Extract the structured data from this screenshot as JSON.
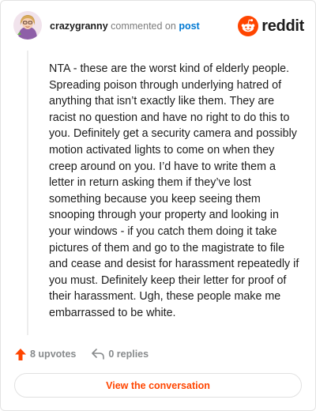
{
  "header": {
    "username": "crazygranny",
    "commented_text": "commented on",
    "post_link": "post",
    "brand_name": "reddit",
    "avatar_icon": "user-avatar-icon",
    "brand_icon": "reddit-snoo-icon"
  },
  "comment": {
    "body": "NTA - these are the worst kind of elderly people. Spreading poison through underlying hatred of anything that isn’t exactly like them. They are racist no question and have no right to do this to you. Definitely get a security camera and possibly motion activated lights to come on when they creep around on you. I’d have to write them a letter in return asking them if they’ve lost something because you keep seeing them snooping through your property and looking in your windows - if you catch them doing it take pictures of them and go to the magistrate to file and cease and desist for harassment repeatedly if you must. Definitely keep their letter for proof of their harassment. Ugh, these people make me embarrassed to be white."
  },
  "actions": {
    "upvotes": "8 upvotes",
    "replies": "0 replies",
    "upvote_icon": "upvote-arrow-icon",
    "reply_icon": "reply-arrow-icon"
  },
  "cta": {
    "label": "View the conversation"
  },
  "colors": {
    "accent": "#ff4500",
    "link": "#0079d3",
    "text": "#1c1c1c",
    "muted": "#878a8c"
  }
}
